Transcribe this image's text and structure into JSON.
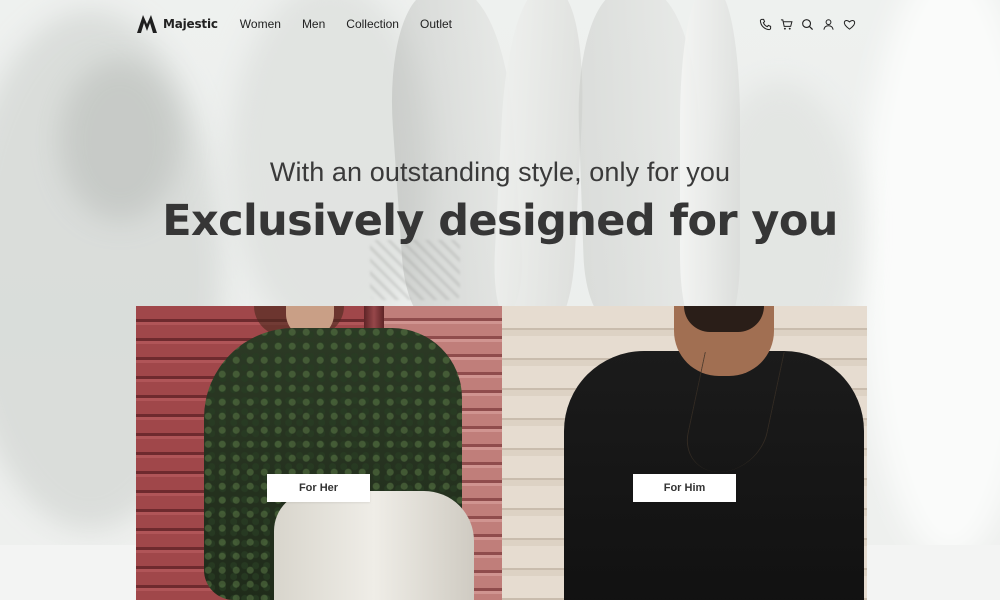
{
  "brand": {
    "name": "Majestic",
    "logo_icon": "majestic-m-logo"
  },
  "nav": {
    "items": [
      {
        "label": "Women"
      },
      {
        "label": "Men"
      },
      {
        "label": "Collection"
      },
      {
        "label": "Outlet"
      }
    ],
    "icons": [
      "phone-icon",
      "cart-icon",
      "search-icon",
      "user-icon",
      "heart-icon"
    ]
  },
  "hero": {
    "tagline": "With an outstanding style, only for you",
    "headline": "Exclusively designed for you"
  },
  "cards": [
    {
      "button_label": "For Her",
      "image": "woman-green-paisley-blouse-red-shutter"
    },
    {
      "button_label": "For Him",
      "image": "man-black-tshirt-beige-wall"
    }
  ],
  "colors": {
    "text_dark": "#2f2f2f",
    "background": "#f4f5f4",
    "button_bg": "#ffffff"
  }
}
